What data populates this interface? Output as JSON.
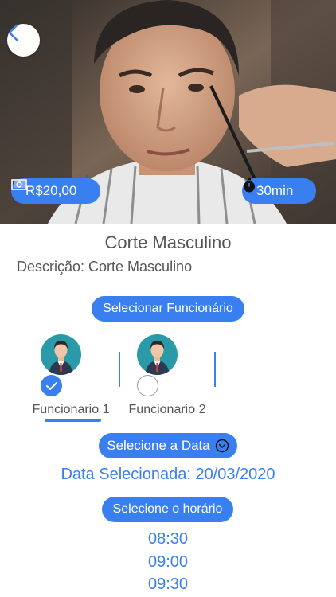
{
  "header": {
    "price": "R$20,00",
    "duration": "30min"
  },
  "service": {
    "title": "Corte Masculino",
    "description_label": "Descrição:",
    "description_value": "Corte Masculino"
  },
  "employees": {
    "select_label": "Selecionar Funcionário",
    "items": [
      {
        "name": "Funcionario 1",
        "selected": true
      },
      {
        "name": "Funcionario 2",
        "selected": false
      }
    ]
  },
  "date": {
    "select_label": "Selecione a Data",
    "selected_text": "Data Selecionada: 20/03/2020"
  },
  "time": {
    "select_label": "Selecione o horário",
    "slots": [
      "08:30",
      "09:00",
      "09:30"
    ]
  },
  "colors": {
    "accent": "#3a7ff0",
    "avatar_bg": "#2a9aa8"
  }
}
